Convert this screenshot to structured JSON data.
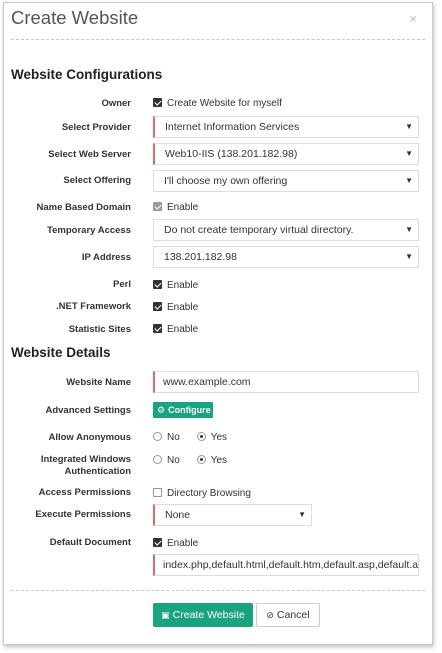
{
  "dialog": {
    "title": "Create Website",
    "close_glyph": "×"
  },
  "section1": {
    "title": "Website Configurations",
    "owner": {
      "label": "Owner",
      "checkbox_label": "Create Website for myself",
      "checked": true
    },
    "provider": {
      "label": "Select Provider",
      "value": "Internet Information Services"
    },
    "web_server": {
      "label": "Select Web Server",
      "value": "Web10-IIS (138.201.182.98)"
    },
    "offering": {
      "label": "Select Offering",
      "value": "I'll choose my own offering"
    },
    "name_based_domain": {
      "label": "Name Based Domain",
      "checkbox_label": "Enable",
      "checked": true,
      "disabled": true
    },
    "temporary_access": {
      "label": "Temporary Access",
      "value": "Do not create temporary virtual directory."
    },
    "ip_address": {
      "label": "IP Address",
      "value": "138.201.182.98"
    },
    "perl": {
      "label": "Perl",
      "checkbox_label": "Enable",
      "checked": true
    },
    "net_framework": {
      "label": ".NET Framework",
      "checkbox_label": "Enable",
      "checked": true
    },
    "statistic_sites": {
      "label": "Statistic Sites",
      "checkbox_label": "Enable",
      "checked": true
    }
  },
  "section2": {
    "title": "Website Details",
    "website_name": {
      "label": "Website Name",
      "value": "www.example.com"
    },
    "advanced_settings": {
      "label": "Advanced Settings",
      "button_label": "Configure",
      "icon": "gears-icon"
    },
    "allow_anonymous": {
      "label": "Allow Anonymous",
      "options": [
        "No",
        "Yes"
      ],
      "selected": "Yes"
    },
    "integrated_windows_auth": {
      "label": "Integrated Windows Authentication",
      "options": [
        "No",
        "Yes"
      ],
      "selected": "Yes"
    },
    "access_permissions": {
      "label": "Access Permissions",
      "checkbox_label": "Directory Browsing",
      "checked": false
    },
    "execute_permissions": {
      "label": "Execute Permissions",
      "value": "None"
    },
    "default_document": {
      "label": "Default Document",
      "checkbox_label": "Enable",
      "checked": true,
      "value": "index.php,default.html,default.htm,default.asp,default.aspx"
    }
  },
  "footer": {
    "create_label": "Create Website",
    "create_icon": "save-icon",
    "cancel_label": "Cancel",
    "cancel_icon": "cancel-circle-icon"
  },
  "colors": {
    "accent": "#1aa37f",
    "required_border": "#e06b6b"
  }
}
